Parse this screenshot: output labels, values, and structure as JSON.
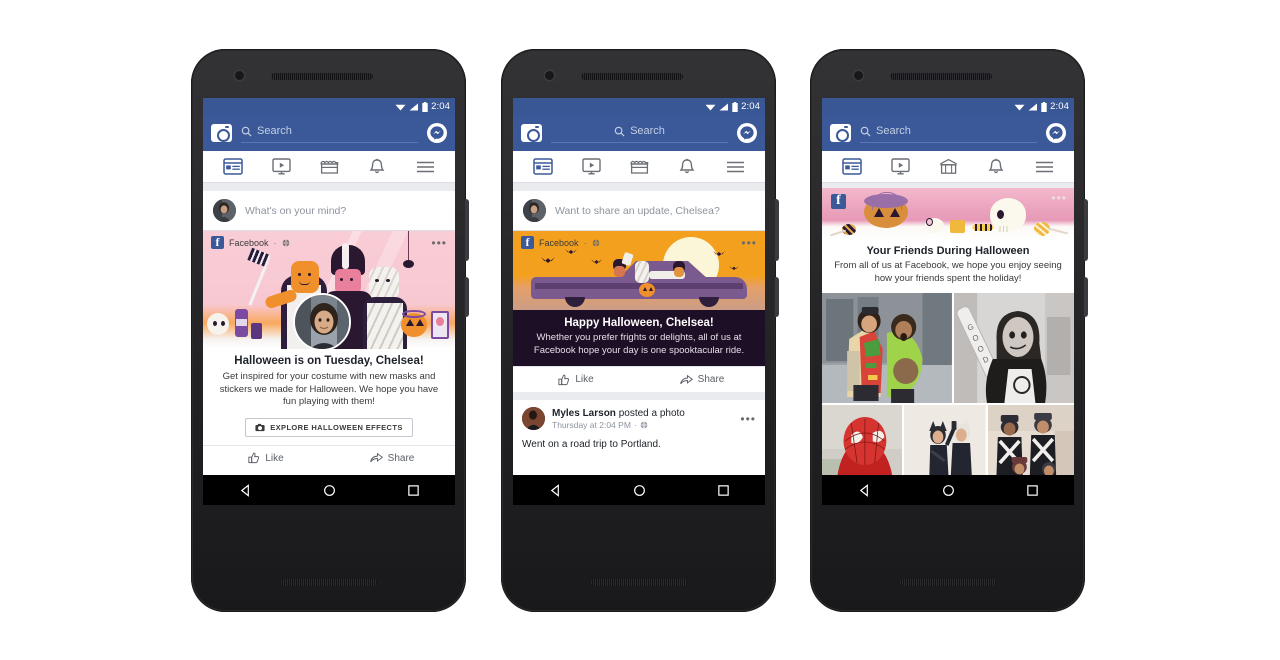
{
  "colors": {
    "fb_blue": "#3b5998",
    "status_blue": "#3a5795",
    "grey_bg": "#e9ebee",
    "dark_purple": "#1d0f26",
    "pink": "#f7c9d3",
    "orange": "#f29d1f",
    "text_dark": "#1d2129",
    "text_muted": "#8d949e"
  },
  "status_bar": {
    "time": "2:04",
    "icons": [
      "wifi-icon",
      "signal-icon",
      "battery-icon"
    ]
  },
  "header": {
    "camera_icon": "camera-icon",
    "search_placeholder": "Search",
    "search_icon": "search-icon",
    "messenger_icon": "messenger-icon"
  },
  "tabs": [
    {
      "name": "news-feed",
      "icon": "news-feed-icon",
      "active": true
    },
    {
      "name": "watch",
      "icon": "video-icon",
      "active": false
    },
    {
      "name": "marketplace",
      "icon": "shop-icon",
      "active": false
    },
    {
      "name": "notifications",
      "icon": "bell-icon",
      "active": false
    },
    {
      "name": "menu",
      "icon": "hamburger-menu-icon",
      "active": false
    }
  ],
  "phones": [
    {
      "id": "phone-1",
      "composer": {
        "placeholder": "What's on your mind?",
        "avatar": "user-avatar"
      },
      "card": {
        "page_name": "Facebook",
        "separator": "·",
        "privacy_icon": "globe-icon",
        "more_icon": "more-options-icon",
        "illustration": "halloween-costume-group-illustration",
        "title": "Halloween is on Tuesday, Chelsea!",
        "body": "Get inspired for your costume with new masks and stickers we made for Halloween. We hope you have fun playing with them!",
        "cta_label": "EXPLORE HALLOWEEN EFFECTS",
        "cta_icon": "camera-icon",
        "actions": [
          {
            "label": "Like",
            "icon": "thumbs-up-icon"
          },
          {
            "label": "Share",
            "icon": "share-arrow-icon"
          }
        ]
      }
    },
    {
      "id": "phone-2",
      "composer": {
        "placeholder": "Want to share an update, Chelsea?",
        "avatar": "user-avatar"
      },
      "card": {
        "page_name": "Facebook",
        "separator": "·",
        "privacy_icon": "globe-icon",
        "more_icon": "more-options-icon",
        "illustration": "halloween-car-ride-illustration",
        "title": "Happy Halloween, Chelsea!",
        "body": "Whether you prefer frights or delights, all of us at Facebook hope your day is one spooktacular ride.",
        "actions": [
          {
            "label": "Like",
            "icon": "thumbs-up-icon"
          },
          {
            "label": "Share",
            "icon": "share-arrow-icon"
          }
        ]
      },
      "post": {
        "author": "Myles Larson",
        "action_text": " posted a photo",
        "timestamp": "Thursday at 2:04 PM",
        "separator": "·",
        "privacy_icon": "globe-icon",
        "more_icon": "more-options-icon",
        "message": "Went on a road trip to Portland.",
        "avatar": "user-avatar"
      }
    },
    {
      "id": "phone-3",
      "banner": {
        "logo_icon": "facebook-logo-icon",
        "more_icon": "more-options-icon",
        "illustration": "halloween-pumpkin-skull-banner",
        "title": "Your Friends During Halloween",
        "body": "From all of us at Facebook, we hope you enjoy seeing how your friends spent the holiday!"
      },
      "photos": [
        {
          "name": "photo-taco-avocado-costumes"
        },
        {
          "name": "photo-harley-quinn-costume"
        },
        {
          "name": "photo-spiderman-costume"
        },
        {
          "name": "photo-cat-costumes-selfie"
        },
        {
          "name": "photo-family-costumes"
        }
      ]
    }
  ],
  "android_nav": [
    {
      "name": "back-button",
      "icon": "triangle-back-icon"
    },
    {
      "name": "home-button",
      "icon": "circle-home-icon"
    },
    {
      "name": "recents-button",
      "icon": "square-recents-icon"
    }
  ]
}
